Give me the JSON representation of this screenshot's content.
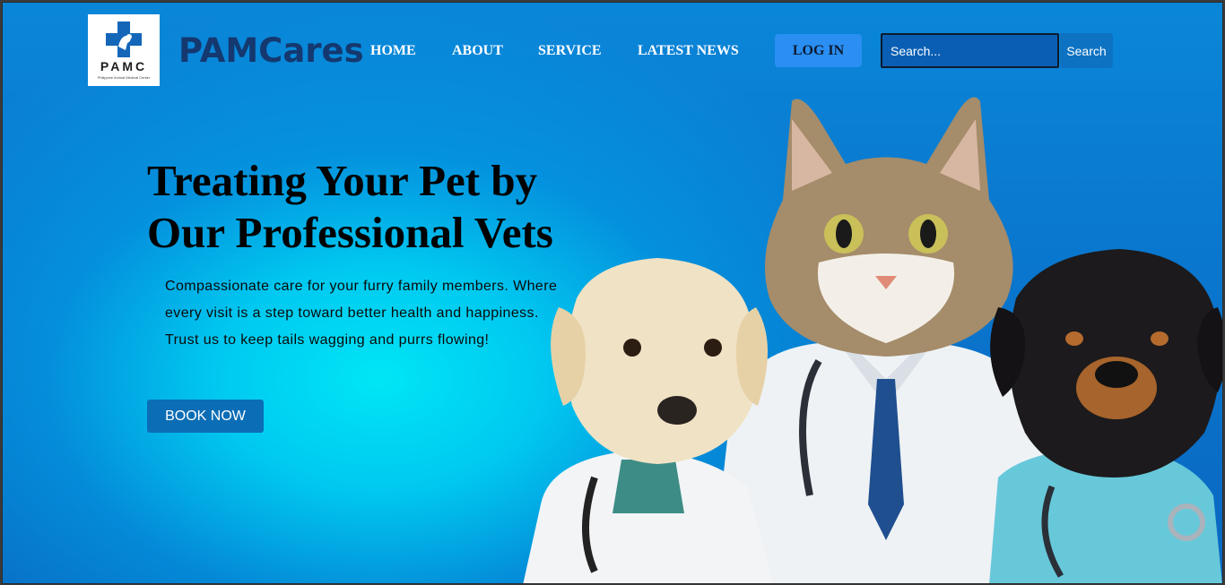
{
  "logo": {
    "letters": "PAMC",
    "subtitle": "Philippine Animal Medical Center"
  },
  "brand": {
    "name": "PAMCares"
  },
  "nav": {
    "items": [
      {
        "label": "HOME"
      },
      {
        "label": "ABOUT"
      },
      {
        "label": "SERVICE"
      },
      {
        "label": "LATEST NEWS"
      }
    ],
    "login_label": "LOG IN"
  },
  "search": {
    "placeholder": "Search...",
    "button_label": "Search"
  },
  "hero": {
    "title_line1": "Treating Your Pet by",
    "title_line2": "Our Professional Vets",
    "text": "Compassionate care for your furry family members. Where every visit is a step toward better health and happiness. Trust us to keep tails wagging and purrs flowing!",
    "cta_label": "BOOK NOW",
    "image_subject": "puppy, cat and rottweiler dressed as veterinarians"
  },
  "colors": {
    "brand_text": "#14386f",
    "login_button": "#2a8ef2",
    "cta_button": "#0b6db5",
    "background_top": "#0a78cf",
    "background_glow": "#00e6f6"
  }
}
